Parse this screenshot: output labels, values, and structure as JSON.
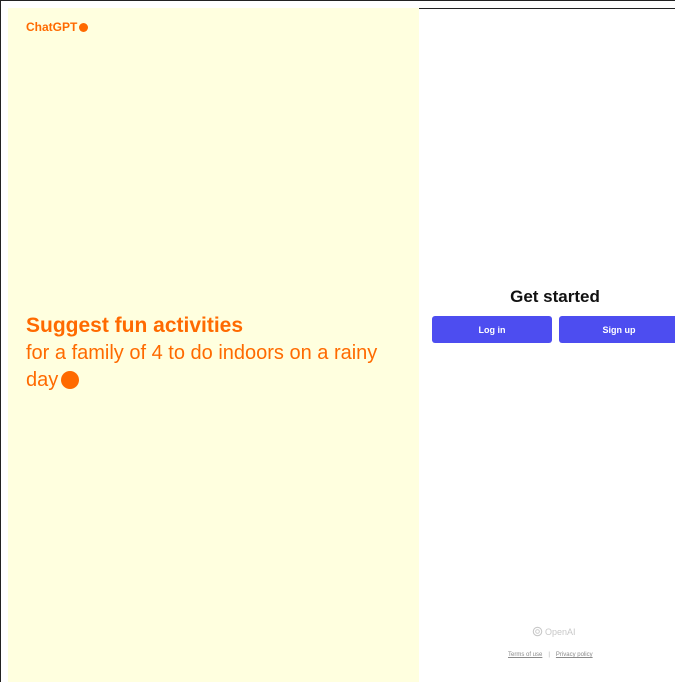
{
  "brand": {
    "name": "ChatGPT",
    "color": "#ff6a00"
  },
  "hero": {
    "title": "Suggest fun activities",
    "body": "for a family of 4 to do indoors on a rainy day"
  },
  "auth": {
    "heading": "Get started",
    "login_label": "Log in",
    "signup_label": "Sign up",
    "button_color": "#4d4df0"
  },
  "footer": {
    "logo_text": "OpenAI",
    "logo_icon": "openai-logo-icon",
    "terms_label": "Terms of use",
    "separator": "|",
    "privacy_label": "Privacy policy"
  },
  "colors": {
    "left_background": "#ffffdf",
    "right_background": "#ffffff"
  }
}
